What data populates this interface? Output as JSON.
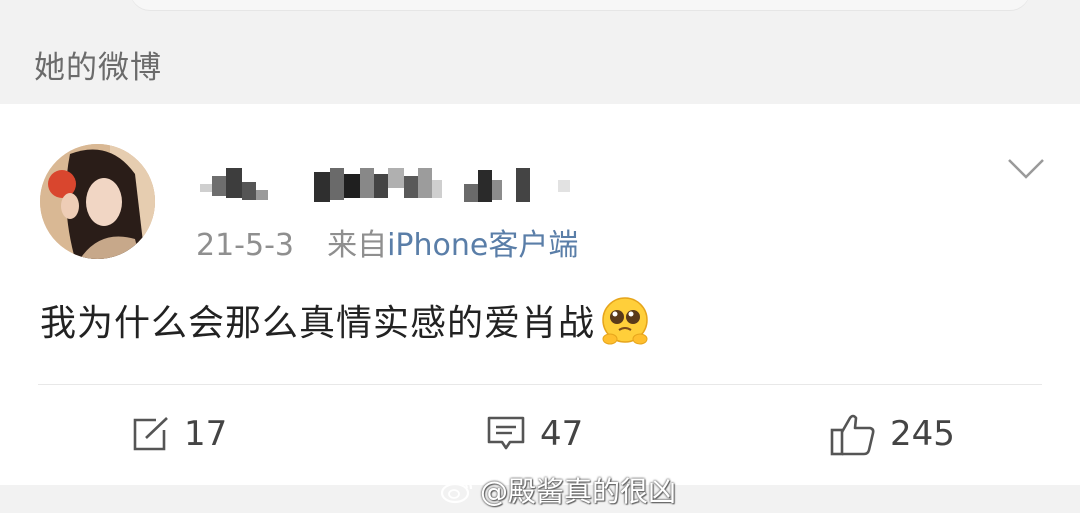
{
  "section": {
    "title": "她的微博"
  },
  "post": {
    "username": "",
    "timestamp": "21-5-3",
    "source_prefix": "来自",
    "source": "iPhone客户端",
    "text": "我为什么会那么真情实感的爱肖战",
    "emoji": "pleading-face"
  },
  "actions": {
    "repost_count": "17",
    "comment_count": "47",
    "like_count": "245"
  },
  "watermark": {
    "text": "@殿酱真的很凶"
  },
  "colors": {
    "background": "#f2f2f2",
    "card": "#ffffff",
    "source_link": "#5a7ea8",
    "meta_text": "#8f8f8f"
  }
}
